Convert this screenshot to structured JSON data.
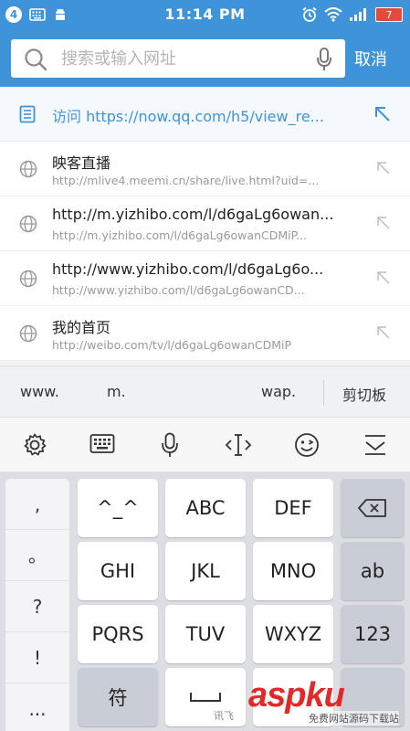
{
  "status_bar": {
    "badge": "4",
    "time": "11:14 PM",
    "battery": "7"
  },
  "search": {
    "placeholder": "搜索或输入网址",
    "cancel_label": "取消"
  },
  "suggestions": {
    "visit": "访问 https://now.qq.com/h5/view_re...",
    "items": [
      {
        "title": "映客直播",
        "url": "http://mlive4.meemi.cn/share/live.html?uid=..."
      },
      {
        "title": "http://m.yizhibo.com/l/d6gaLg6owan...",
        "url": "http://m.yizhibo.com/l/d6gaLg6owanCDMiP..."
      },
      {
        "title": "http://www.yizhibo.com/l/d6gaLg6o...",
        "url": "http://www.yizhibo.com/l/d6gaLg6owanCD..."
      },
      {
        "title": "我的首页",
        "url": "http://weibo.com/tv/l/d6gaLg6owanCDMiP"
      }
    ]
  },
  "quickbar": {
    "www": "www.",
    "m": "m.",
    "wap": "wap.",
    "clipboard": "剪切板"
  },
  "keyboard": {
    "punctuation": [
      ",",
      "。",
      "?",
      "!",
      "..."
    ],
    "keys": {
      "emoticon": "^_^",
      "abc": "ABC",
      "def": "DEF",
      "ghi": "GHI",
      "jkl": "JKL",
      "mno": "MNO",
      "ab": "ab",
      "pqrs": "PQRS",
      "tuv": "TUV",
      "wxyz": "WXYZ",
      "num": "123",
      "symbol": "符",
      "space_brand": "讯飞"
    }
  },
  "watermark": {
    "logo": "aspku",
    "sub": "免费网站源码下载站"
  },
  "colors": {
    "accent": "#3f93d9",
    "battery": "#e24a3b"
  }
}
